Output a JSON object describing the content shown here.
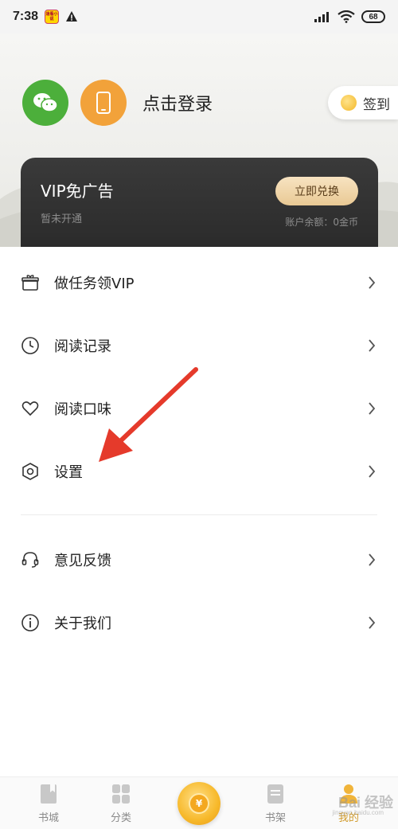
{
  "status_bar": {
    "time": "7:38",
    "app_badge": "速看小说",
    "battery": "68"
  },
  "header": {
    "login_text": "点击登录",
    "checkin_label": "签到",
    "wechat_icon": "wechat-icon",
    "phone_icon": "phone-icon"
  },
  "vip": {
    "title": "VIP免广告",
    "subtitle": "暂未开通",
    "redeem_label": "立即兑换",
    "balance": "账户余额：0金币"
  },
  "menu": {
    "items": [
      {
        "label": "做任务领VIP",
        "icon": "gift-icon"
      },
      {
        "label": "阅读记录",
        "icon": "clock-icon"
      },
      {
        "label": "阅读口味",
        "icon": "heart-icon"
      },
      {
        "label": "设置",
        "icon": "settings-hexagon-icon"
      },
      {
        "label": "意见反馈",
        "icon": "headset-icon"
      },
      {
        "label": "关于我们",
        "icon": "info-icon"
      }
    ]
  },
  "tabbar": {
    "tabs": [
      {
        "label": "书城",
        "icon": "book-icon"
      },
      {
        "label": "分类",
        "icon": "grid-icon"
      },
      {
        "label": "",
        "icon": "coin-icon"
      },
      {
        "label": "书架",
        "icon": "shelf-icon"
      },
      {
        "label": "我的",
        "icon": "user-icon"
      }
    ],
    "active": "我的"
  },
  "watermark": {
    "text": "Bai 经验",
    "sub": "jingyan.baidu.com"
  },
  "colors": {
    "wechat": "#4caf3b",
    "phone": "#f2a23a",
    "vip_card": "#2f2f2f",
    "accent_gold": "#d09a2a",
    "annotation_arrow": "#e53a2b"
  }
}
